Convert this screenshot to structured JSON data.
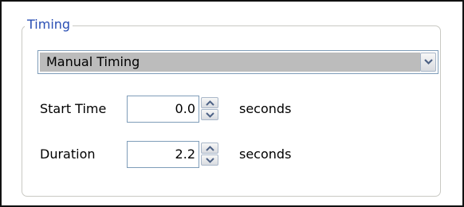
{
  "group": {
    "title": "Timing"
  },
  "timing_mode": {
    "selected": "Manual Timing",
    "arrow_icon": "chevron-down-icon"
  },
  "start_time": {
    "label": "Start Time",
    "value": "0.0",
    "unit": "seconds"
  },
  "duration": {
    "label": "Duration",
    "value": "2.2",
    "unit": "seconds"
  },
  "colors": {
    "legend_text": "#2a4fb4",
    "field_border": "#7f9db9",
    "combo_selected_bg": "#bcbcbc"
  }
}
